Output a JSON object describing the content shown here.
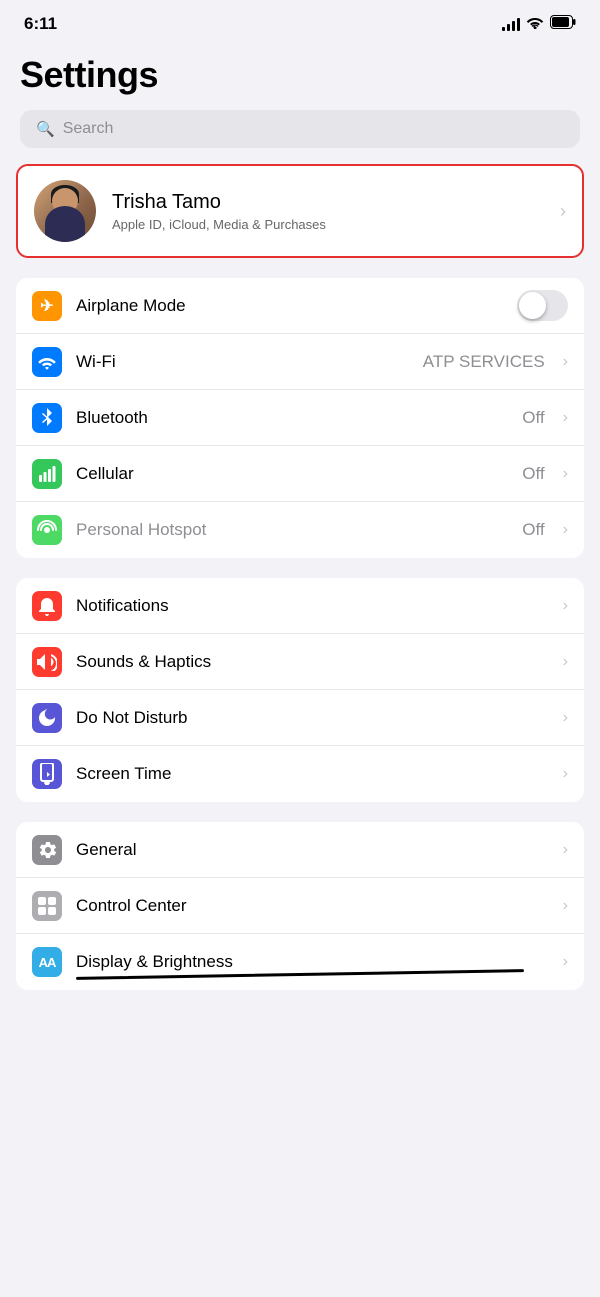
{
  "statusBar": {
    "time": "6:11",
    "signal": "signal",
    "wifi": "wifi",
    "battery": "battery"
  },
  "header": {
    "title": "Settings"
  },
  "search": {
    "placeholder": "Search"
  },
  "profile": {
    "name": "Trisha Tamo",
    "subtitle": "Apple ID, iCloud, Media & Purchases"
  },
  "group1": {
    "items": [
      {
        "id": "airplane-mode",
        "label": "Airplane Mode",
        "iconColor": "icon-orange",
        "iconSymbol": "✈",
        "type": "toggle",
        "value": "",
        "toggled": false
      },
      {
        "id": "wifi",
        "label": "Wi-Fi",
        "iconColor": "icon-blue",
        "iconSymbol": "wifi",
        "type": "value",
        "value": "ATP SERVICES"
      },
      {
        "id": "bluetooth",
        "label": "Bluetooth",
        "iconColor": "icon-blue-dark",
        "iconSymbol": "bluetooth",
        "type": "value",
        "value": "Off"
      },
      {
        "id": "cellular",
        "label": "Cellular",
        "iconColor": "icon-green",
        "iconSymbol": "cellular",
        "type": "value",
        "value": "Off"
      },
      {
        "id": "hotspot",
        "label": "Personal Hotspot",
        "iconColor": "icon-green-light",
        "iconSymbol": "hotspot",
        "type": "value",
        "value": "Off",
        "dimmed": true
      }
    ]
  },
  "group2": {
    "items": [
      {
        "id": "notifications",
        "label": "Notifications",
        "iconColor": "icon-red",
        "iconSymbol": "notif",
        "type": "chevron"
      },
      {
        "id": "sounds",
        "label": "Sounds & Haptics",
        "iconColor": "icon-red-pink",
        "iconSymbol": "sound",
        "type": "chevron"
      },
      {
        "id": "do-not-disturb",
        "label": "Do Not Disturb",
        "iconColor": "icon-indigo",
        "iconSymbol": "moon",
        "type": "chevron"
      },
      {
        "id": "screen-time",
        "label": "Screen Time",
        "iconColor": "icon-purple",
        "iconSymbol": "hourglass",
        "type": "chevron"
      }
    ]
  },
  "group3": {
    "items": [
      {
        "id": "general",
        "label": "General",
        "iconColor": "icon-gray",
        "iconSymbol": "gear",
        "type": "chevron"
      },
      {
        "id": "control-center",
        "label": "Control Center",
        "iconColor": "icon-gray-light",
        "iconSymbol": "control",
        "type": "chevron"
      },
      {
        "id": "display",
        "label": "Display & Brightness",
        "iconColor": "icon-teal",
        "iconSymbol": "AA",
        "type": "chevron",
        "scribble": true
      }
    ]
  }
}
